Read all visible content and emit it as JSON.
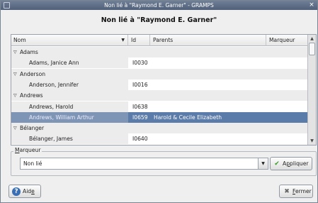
{
  "window": {
    "title": "Non lié à \"Raymond E. Garner\" - GRAMPS",
    "close_glyph": "×"
  },
  "dialog": {
    "heading": "Non lié à \"Raymond E. Garner\""
  },
  "tree": {
    "columns": [
      "Nom",
      "Id",
      "Parents",
      "Marqueur"
    ],
    "rows": [
      {
        "kind": "group",
        "name": "Adams",
        "id": "",
        "parents": ""
      },
      {
        "kind": "item",
        "name": "Adams, Janice Ann",
        "id": "I0030",
        "parents": ""
      },
      {
        "kind": "group",
        "name": "Anderson",
        "id": "",
        "parents": ""
      },
      {
        "kind": "item",
        "name": "Anderson, Jennifer",
        "id": "I0016",
        "parents": ""
      },
      {
        "kind": "group",
        "name": "Andrews",
        "id": "",
        "parents": ""
      },
      {
        "kind": "item",
        "name": "Andrews, Harold",
        "id": "I0638",
        "parents": ""
      },
      {
        "kind": "item",
        "name": "Andrews, William Arthur",
        "id": "I0659",
        "parents": "Harold & Cecile Elizabeth",
        "selected": true
      },
      {
        "kind": "group",
        "name": "Bélanger",
        "id": "",
        "parents": ""
      },
      {
        "kind": "item",
        "name": "Bélanger, James",
        "id": "I0640",
        "parents": ""
      }
    ]
  },
  "marker": {
    "frame_label_first": "M",
    "frame_label_rest": "arqueur",
    "selected": "Non lié"
  },
  "buttons": {
    "apply_first": "A",
    "apply_u": "p",
    "apply_rest": "pliquer",
    "help_first": "Aid",
    "help_u": "e",
    "close_u": "F",
    "close_rest": "ermer"
  }
}
